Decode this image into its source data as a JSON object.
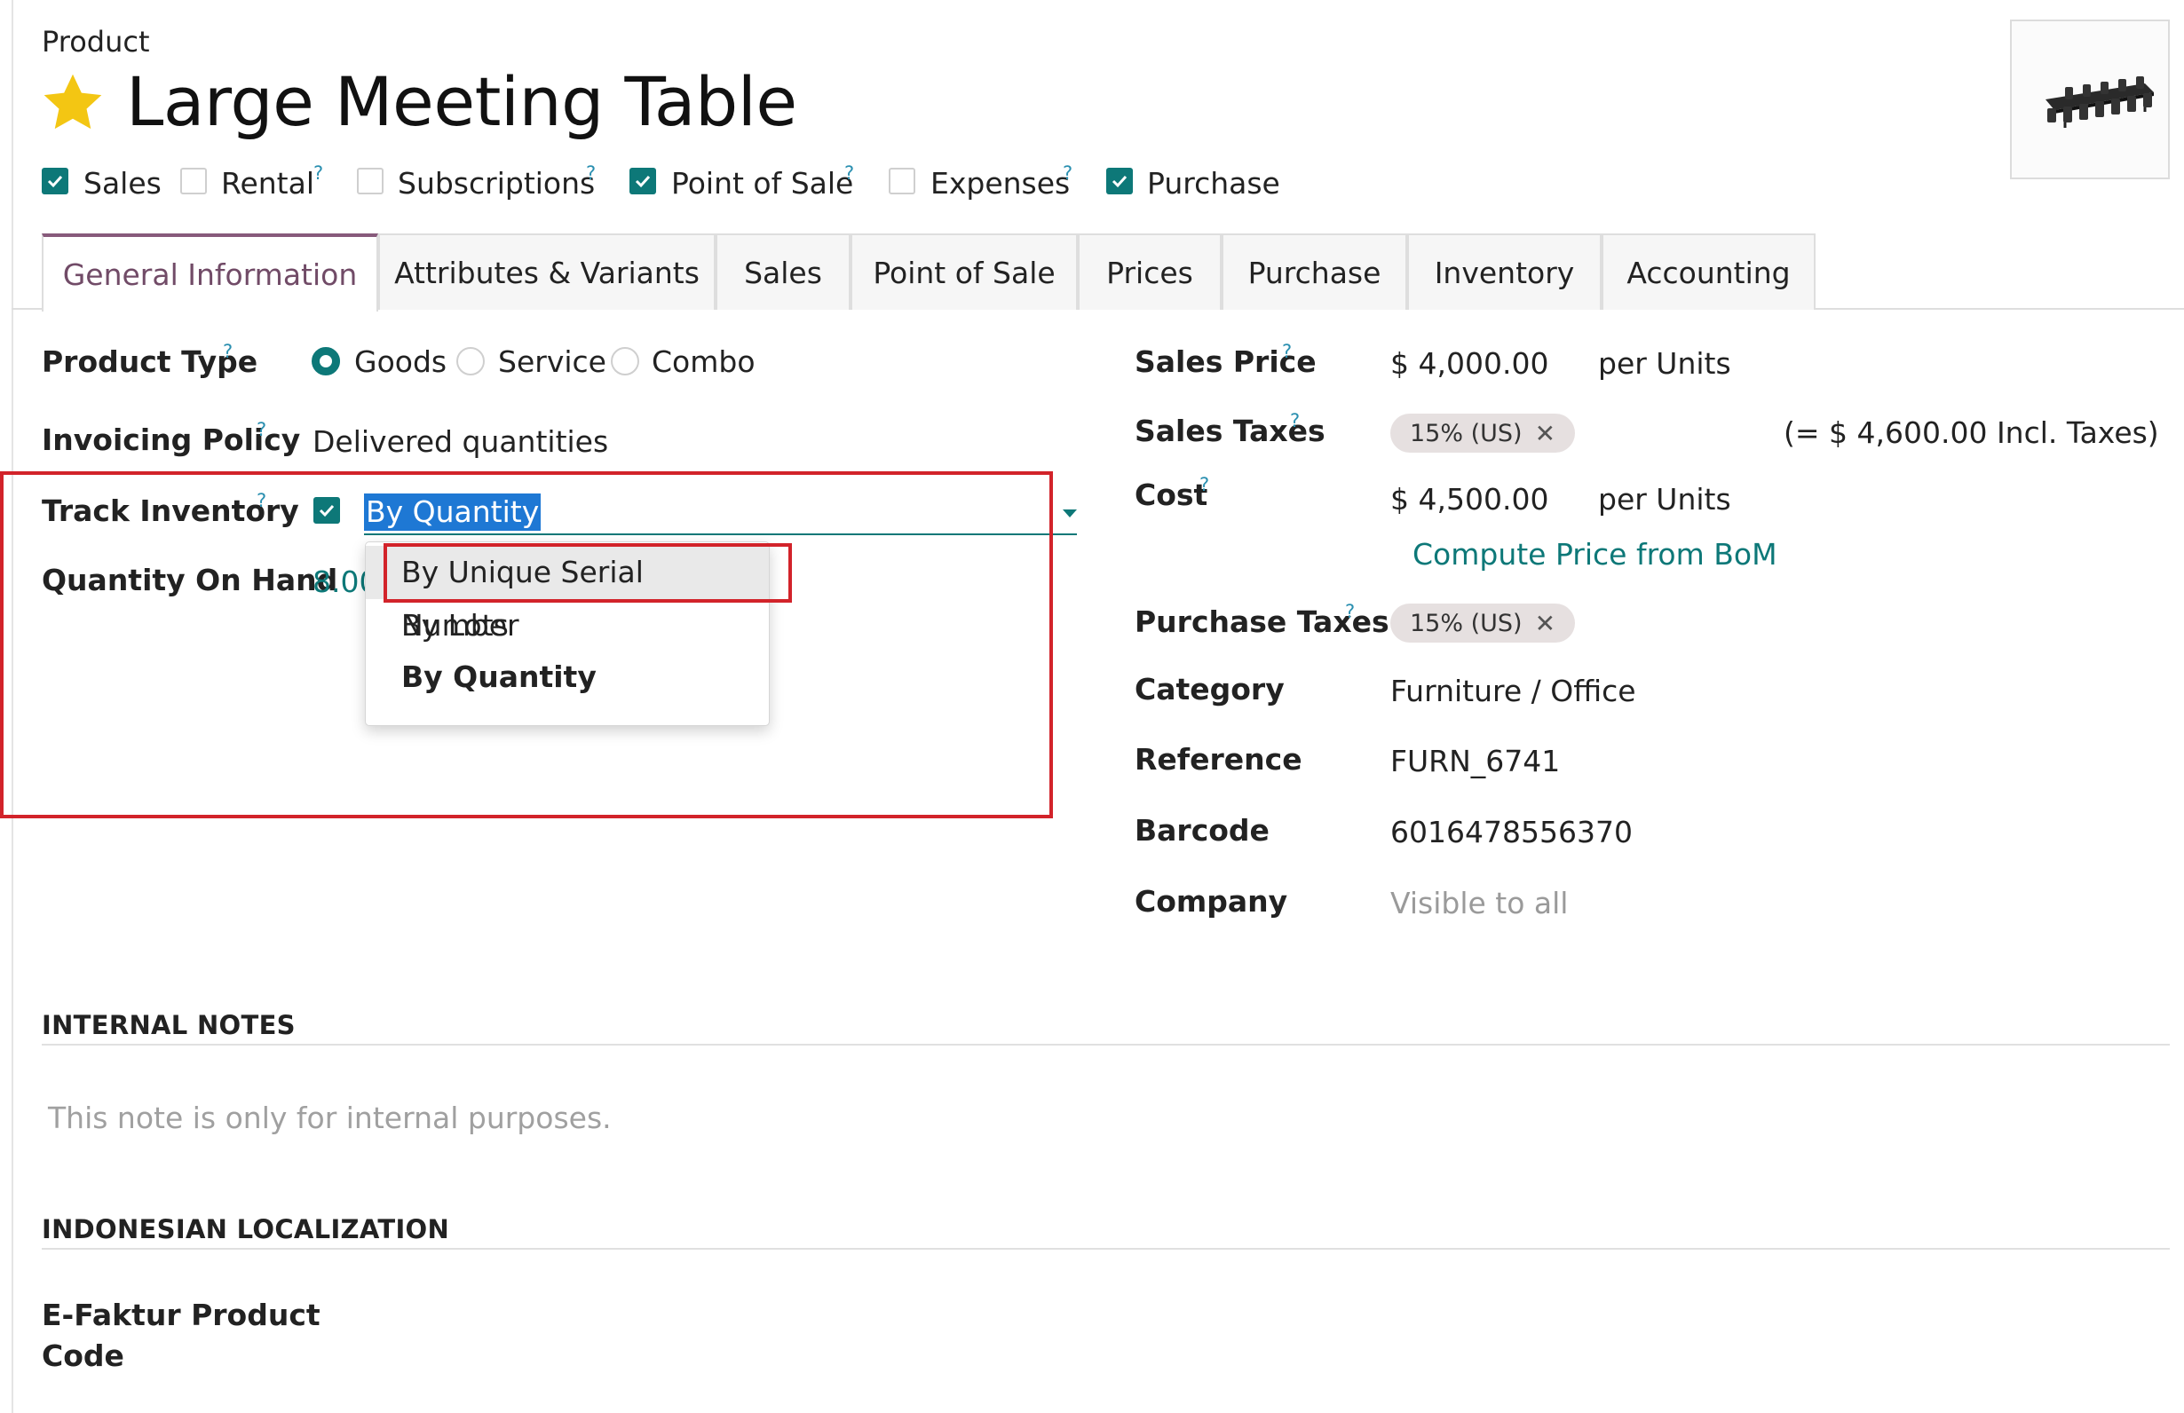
{
  "breadcrumb": "Product",
  "product": {
    "name": "Large Meeting Table",
    "favorite": true
  },
  "flags": [
    {
      "label": "Sales",
      "checked": true,
      "help": false
    },
    {
      "label": "Rental",
      "checked": false,
      "help": true
    },
    {
      "label": "Subscriptions",
      "checked": false,
      "help": true
    },
    {
      "label": "Point of Sale",
      "checked": true,
      "help": true
    },
    {
      "label": "Expenses",
      "checked": false,
      "help": true
    },
    {
      "label": "Purchase",
      "checked": true,
      "help": false
    }
  ],
  "help_mark": "?",
  "tabs": [
    {
      "label": "General Information",
      "active": true
    },
    {
      "label": "Attributes & Variants"
    },
    {
      "label": "Sales"
    },
    {
      "label": "Point of Sale"
    },
    {
      "label": "Prices"
    },
    {
      "label": "Purchase"
    },
    {
      "label": "Inventory"
    },
    {
      "label": "Accounting"
    }
  ],
  "left": {
    "product_type": {
      "label": "Product Type",
      "options": [
        "Goods",
        "Service",
        "Combo"
      ],
      "selected": "Goods"
    },
    "invoicing_policy": {
      "label": "Invoicing Policy",
      "value": "Delivered quantities"
    },
    "track_inventory": {
      "label": "Track Inventory",
      "checked": true,
      "value": "By Quantity"
    },
    "qty_on_hand": {
      "label": "Quantity On Hand",
      "value": "8.00"
    }
  },
  "dropdown": {
    "options": [
      "By Unique Serial Number",
      "By Lots",
      "By Quantity"
    ],
    "highlighted": "By Unique Serial Number",
    "selected": "By Quantity"
  },
  "right": {
    "sales_price": {
      "label": "Sales Price",
      "value": "$ 4,000.00",
      "unit": "per Units"
    },
    "sales_taxes": {
      "label": "Sales Taxes",
      "tag": "15% (US)",
      "incl": "(= $ 4,600.00 Incl. Taxes)"
    },
    "cost": {
      "label": "Cost",
      "value": "$ 4,500.00",
      "unit": "per Units",
      "action": "Compute Price from BoM"
    },
    "purchase_taxes": {
      "label": "Purchase Taxes",
      "tag": "15% (US)"
    },
    "category": {
      "label": "Category",
      "value": "Furniture / Office"
    },
    "reference": {
      "label": "Reference",
      "value": "FURN_6741"
    },
    "barcode": {
      "label": "Barcode",
      "value": "6016478556370"
    },
    "company": {
      "label": "Company",
      "placeholder": "Visible to all"
    }
  },
  "internal_notes": {
    "title": "INTERNAL NOTES",
    "placeholder": "This note is only for internal purposes."
  },
  "localization": {
    "title": "INDONESIAN LOCALIZATION",
    "efaktur_label_line1": "E-Faktur Product",
    "efaktur_label_line2": "Code"
  },
  "colors": {
    "accent": "#0d7878",
    "brand": "#714b67",
    "highlight_box": "#d2232a",
    "selection": "#1e78d4"
  }
}
